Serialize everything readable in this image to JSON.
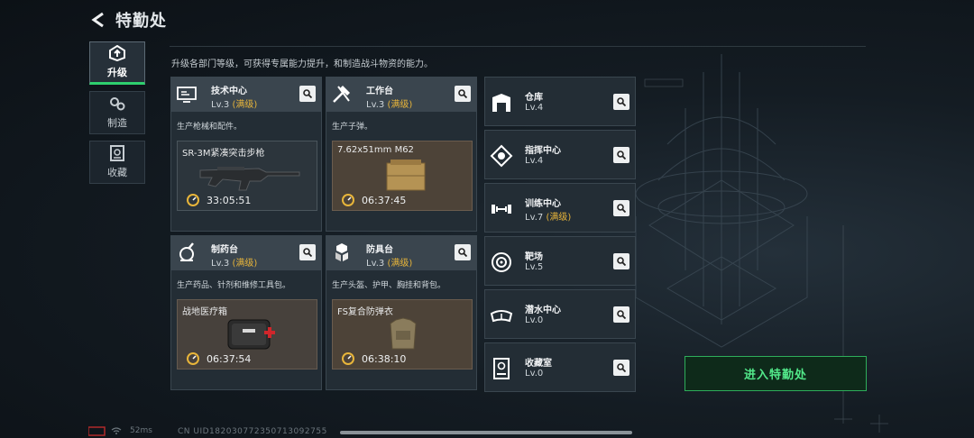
{
  "header": {
    "title": "特勤处"
  },
  "subtitle": "升级各部门等级，可获得专属能力提升，和制造战斗物资的能力。",
  "sidebar": [
    {
      "label": "升级",
      "icon": "upgrade-icon",
      "active": true
    },
    {
      "label": "制造",
      "icon": "gears-icon",
      "active": false
    },
    {
      "label": "收藏",
      "icon": "collection-icon",
      "active": false
    }
  ],
  "cards": [
    {
      "name": "技术中心",
      "level": "Lv.3",
      "max": "(满级)",
      "desc": "生产枪械和配件。",
      "product": "SR-3M紧凑突击步枪",
      "time": "33:05:51",
      "icon": "tech-center-icon"
    },
    {
      "name": "工作台",
      "level": "Lv.3",
      "max": "(满级)",
      "desc": "生产子弹。",
      "product": "7.62x51mm M62",
      "time": "06:37:45",
      "icon": "workbench-icon"
    },
    {
      "name": "制药台",
      "level": "Lv.3",
      "max": "(满级)",
      "desc": "生产药品、针剂和维修工具包。",
      "product": "战地医疗箱",
      "time": "06:37:54",
      "icon": "pharmacy-icon"
    },
    {
      "name": "防具台",
      "level": "Lv.3",
      "max": "(满级)",
      "desc": "生产头盔、护甲、胸挂和背包。",
      "product": "FS复合防弹衣",
      "time": "06:38:10",
      "icon": "armor-bench-icon"
    }
  ],
  "facilities": [
    {
      "name": "仓库",
      "level": "Lv.4",
      "max": "",
      "icon": "warehouse-icon"
    },
    {
      "name": "指挥中心",
      "level": "Lv.4",
      "max": "",
      "icon": "command-center-icon"
    },
    {
      "name": "训练中心",
      "level": "Lv.7",
      "max": "(满级)",
      "icon": "dumbbell-icon"
    },
    {
      "name": "靶场",
      "level": "Lv.5",
      "max": "",
      "icon": "target-icon"
    },
    {
      "name": "潜水中心",
      "level": "Lv.0",
      "max": "",
      "icon": "dive-mask-icon"
    },
    {
      "name": "收藏室",
      "level": "Lv.0",
      "max": "",
      "icon": "collection-room-icon"
    }
  ],
  "enter_button": "进入特勤处",
  "footer": {
    "ping": "52ms",
    "uid": "CN UID18203077235071309275​5"
  },
  "colors": {
    "accent": "#2ed06e",
    "max_level": "#e8b53a",
    "enter_text": "#52e98a"
  }
}
